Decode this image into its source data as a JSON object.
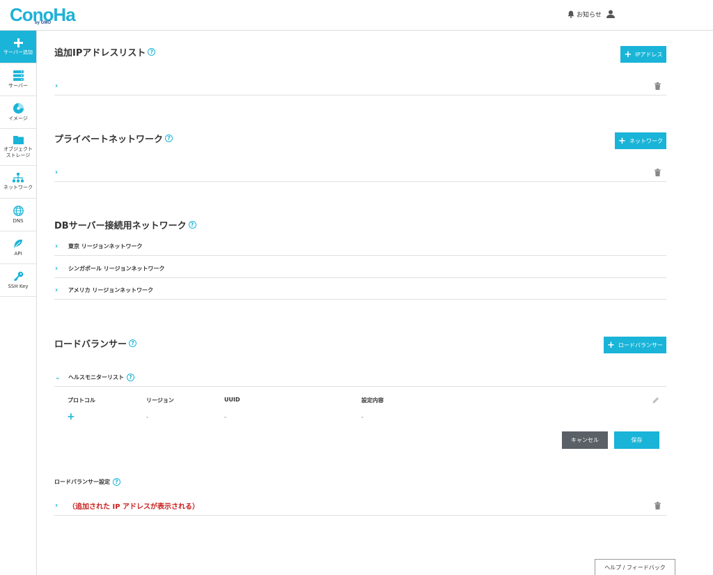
{
  "header": {
    "logo": "ConoHa",
    "logo_sub": "by GMO",
    "notice_label": "お知らせ"
  },
  "sidebar": {
    "items": [
      {
        "label": "サーバー追加",
        "icon": "plus-icon"
      },
      {
        "label": "サーバー",
        "icon": "server-icon"
      },
      {
        "label": "イメージ",
        "icon": "disc-icon"
      },
      {
        "label": "オブジェクト\nストレージ",
        "icon": "folder-icon"
      },
      {
        "label": "ネットワーク",
        "icon": "network-icon"
      },
      {
        "label": "DNS",
        "icon": "globe-icon"
      },
      {
        "label": "API",
        "icon": "api-icon"
      },
      {
        "label": "SSH Key",
        "icon": "key-icon"
      }
    ]
  },
  "sections": {
    "additional_ip": {
      "title": "追加IPアドレスリスト",
      "add_button": "IPアドレス"
    },
    "private_network": {
      "title": "プライベートネットワーク",
      "add_button": "ネットワーク"
    },
    "db_network": {
      "title": "DBサーバー接続用ネットワーク",
      "regions": [
        "東京 リージョンネットワーク",
        "シンガポール リージョンネットワーク",
        "アメリカ リージョンネットワーク"
      ]
    },
    "load_balancer": {
      "title": "ロードバランサー",
      "add_button": "ロードバランサー",
      "health_monitor_title": "ヘルスモニターリスト",
      "columns": [
        "プロトコル",
        "リージョン",
        "UUID",
        "設定内容"
      ],
      "row_values": [
        "-",
        "-",
        "-"
      ],
      "cancel_label": "キャンセル",
      "save_label": "保存",
      "settings_title": "ロードバランサー設定",
      "settings_note": "（追加された IP アドレスが表示される）"
    }
  },
  "footer": {
    "help_feedback": "ヘルプ / フィードバック"
  },
  "colors": {
    "accent": "#1ab4d8",
    "dark_button": "#5a6066",
    "note_red": "#c8201e"
  }
}
